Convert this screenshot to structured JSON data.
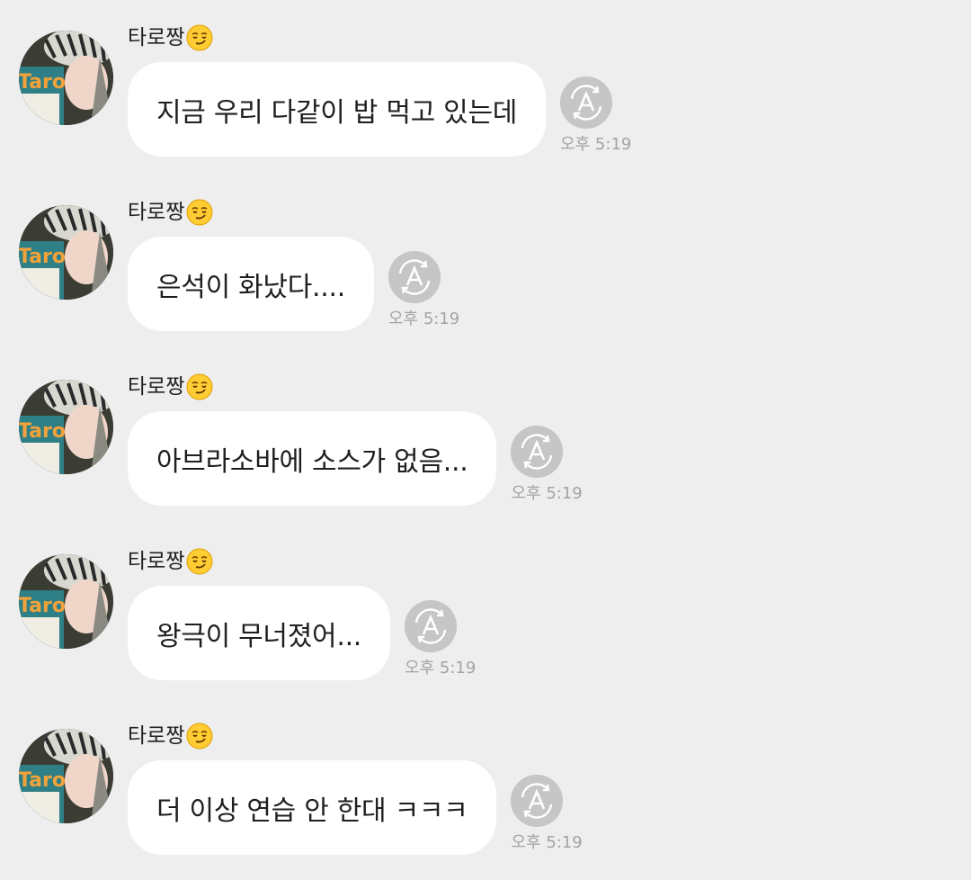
{
  "chat": {
    "messages": [
      {
        "sender": "타로짱",
        "sender_emoji": "smirking-face-icon",
        "text": "지금 우리 다같이 밥 먹고 있는데",
        "time": "오후 5:19"
      },
      {
        "sender": "타로짱",
        "sender_emoji": "smirking-face-icon",
        "text": "은석이 화났다....",
        "time": "오후 5:19"
      },
      {
        "sender": "타로짱",
        "sender_emoji": "smirking-face-icon",
        "text": "아브라소바에 소스가 없음...",
        "time": "오후 5:19"
      },
      {
        "sender": "타로짱",
        "sender_emoji": "smirking-face-icon",
        "text": "왕극이 무너졌어...",
        "time": "오후 5:19"
      },
      {
        "sender": "타로짱",
        "sender_emoji": "smirking-face-icon",
        "text": "더 이상 연습 안 한대 ㅋㅋㅋ",
        "time": "오후 5:19"
      }
    ],
    "translate_icon": "translate-a-icon",
    "avatar_logo_text": "Taro",
    "colors": {
      "background": "#eeeeee",
      "bubble": "#ffffff",
      "translate_button": "#c6c6c6",
      "timestamp": "#a3a3a3"
    }
  }
}
